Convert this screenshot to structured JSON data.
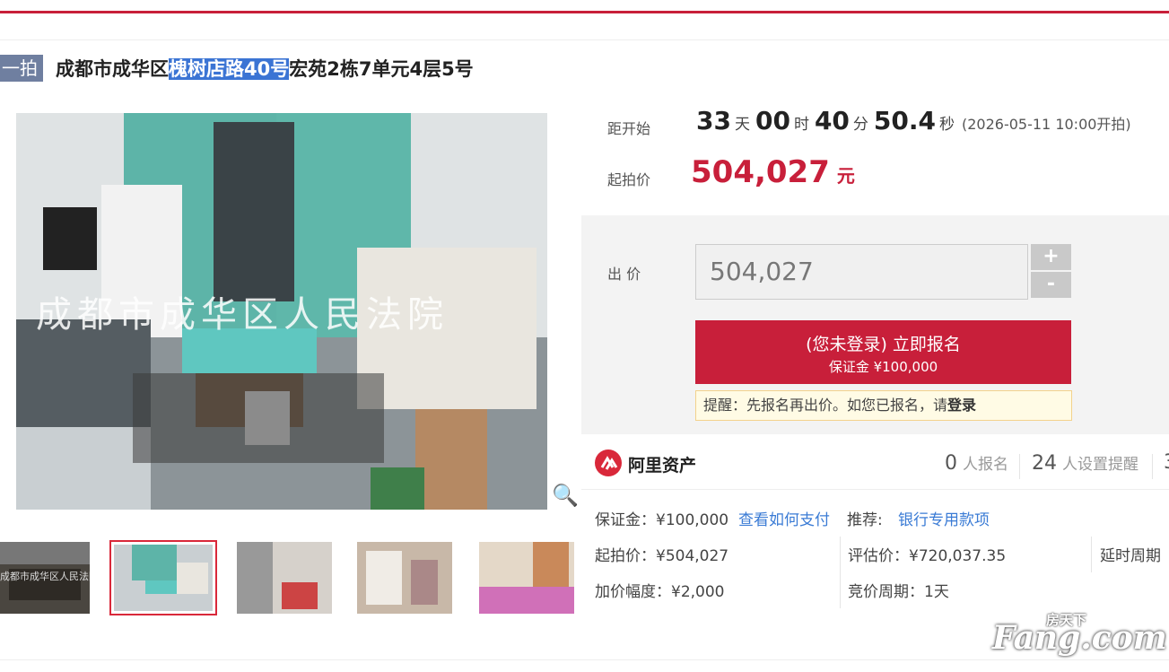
{
  "listing": {
    "tag": "一拍",
    "title_pre": "成都市成华区",
    "title_highlight": "槐树店路40号",
    "title_post": "宏苑2栋7单元4层5号",
    "image_watermark": "成都市成华区人民法院",
    "thumb_watermark": "成都市成华区人民法院"
  },
  "countdown": {
    "label": "距开始",
    "days": "33",
    "days_unit": "天",
    "hours": "00",
    "hours_unit": "时",
    "minutes": "40",
    "minutes_unit": "分",
    "seconds": "50.4",
    "seconds_unit": "秒",
    "start_text": "(2026-05-11 10:00开拍)"
  },
  "start_price": {
    "label": "起拍价",
    "value": "504,027",
    "currency": "元"
  },
  "bid": {
    "label": "出 价",
    "input_value": "504,027",
    "plus": "+",
    "minus": "-",
    "signup_main": "(您未登录) 立即报名",
    "signup_deposit": "保证金 ¥100,000",
    "remind_text": "提醒：先报名再出价。如您已报名，请",
    "remind_login": "登录"
  },
  "platform": {
    "name": "阿里资产",
    "signups_num": "0",
    "signups_label": "人报名",
    "reminders_num": "24",
    "reminders_label": "人设置提醒",
    "views_num": "3"
  },
  "details": {
    "deposit": "保证金：¥100,000",
    "how_to_pay": "查看如何支付",
    "recommend_label": "推荐:",
    "bank_loan": "银行专用款项",
    "start_price": "起拍价：¥504,027",
    "appraisal": "评估价：¥720,037.35",
    "delay_period": "延时周期",
    "increment": "加价幅度：¥2,000",
    "bid_period": "竞价周期：1天"
  },
  "watermark": {
    "line1": "房天下",
    "line2": "Fang.com"
  },
  "colors": {
    "accent": "#c81f3a",
    "link": "#3a7bd5",
    "tag": "#6f7fa0"
  }
}
